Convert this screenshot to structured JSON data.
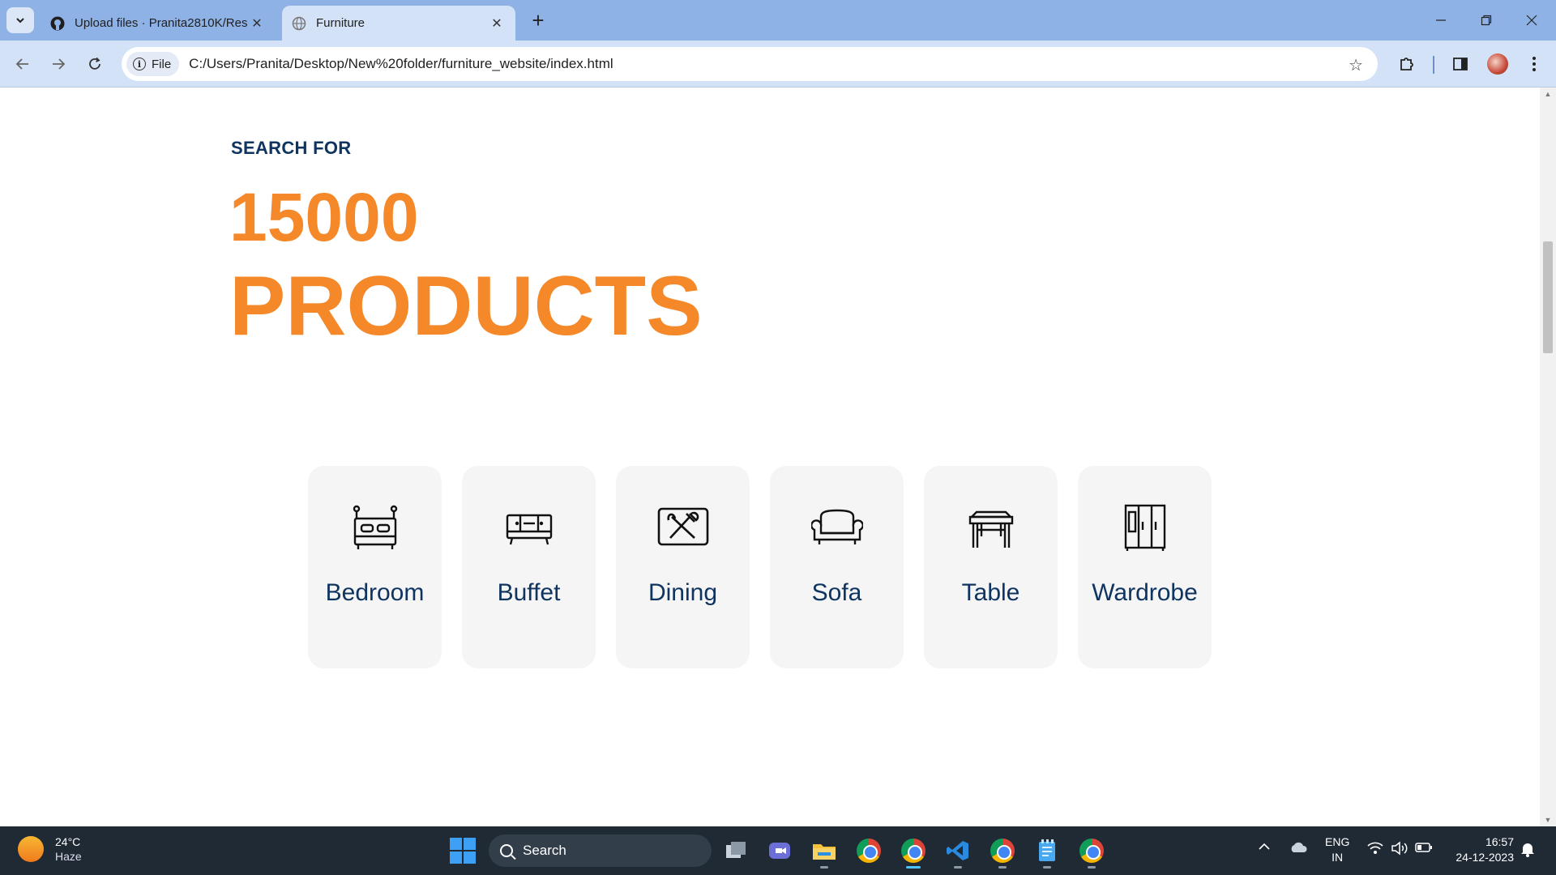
{
  "browser": {
    "tabs": [
      {
        "title": "Upload files · Pranita2810K/Res",
        "active": false,
        "favicon": "github-icon"
      },
      {
        "title": "Furniture",
        "active": true,
        "favicon": "globe-icon"
      }
    ],
    "chip_label": "File",
    "url": "C:/Users/Pranita/Desktop/New%20folder/furniture_website/index.html"
  },
  "hero": {
    "eyebrow": "SEARCH FOR",
    "number": "15000",
    "word": "PRODUCTS"
  },
  "categories": [
    {
      "label": "Bedroom",
      "icon": "bed-icon"
    },
    {
      "label": "Buffet",
      "icon": "buffet-icon"
    },
    {
      "label": "Dining",
      "icon": "dining-icon"
    },
    {
      "label": "Sofa",
      "icon": "sofa-icon"
    },
    {
      "label": "Table",
      "icon": "table-icon"
    },
    {
      "label": "Wardrobe",
      "icon": "wardrobe-icon"
    }
  ],
  "taskbar": {
    "weather_temp": "24°C",
    "weather_desc": "Haze",
    "search_label": "Search",
    "lang_line1": "ENG",
    "lang_line2": "IN",
    "time": "16:57",
    "date": "24-12-2023"
  },
  "colors": {
    "accent_orange": "#f5892a",
    "navy": "#0f3460",
    "card_bg": "#f5f5f5"
  }
}
